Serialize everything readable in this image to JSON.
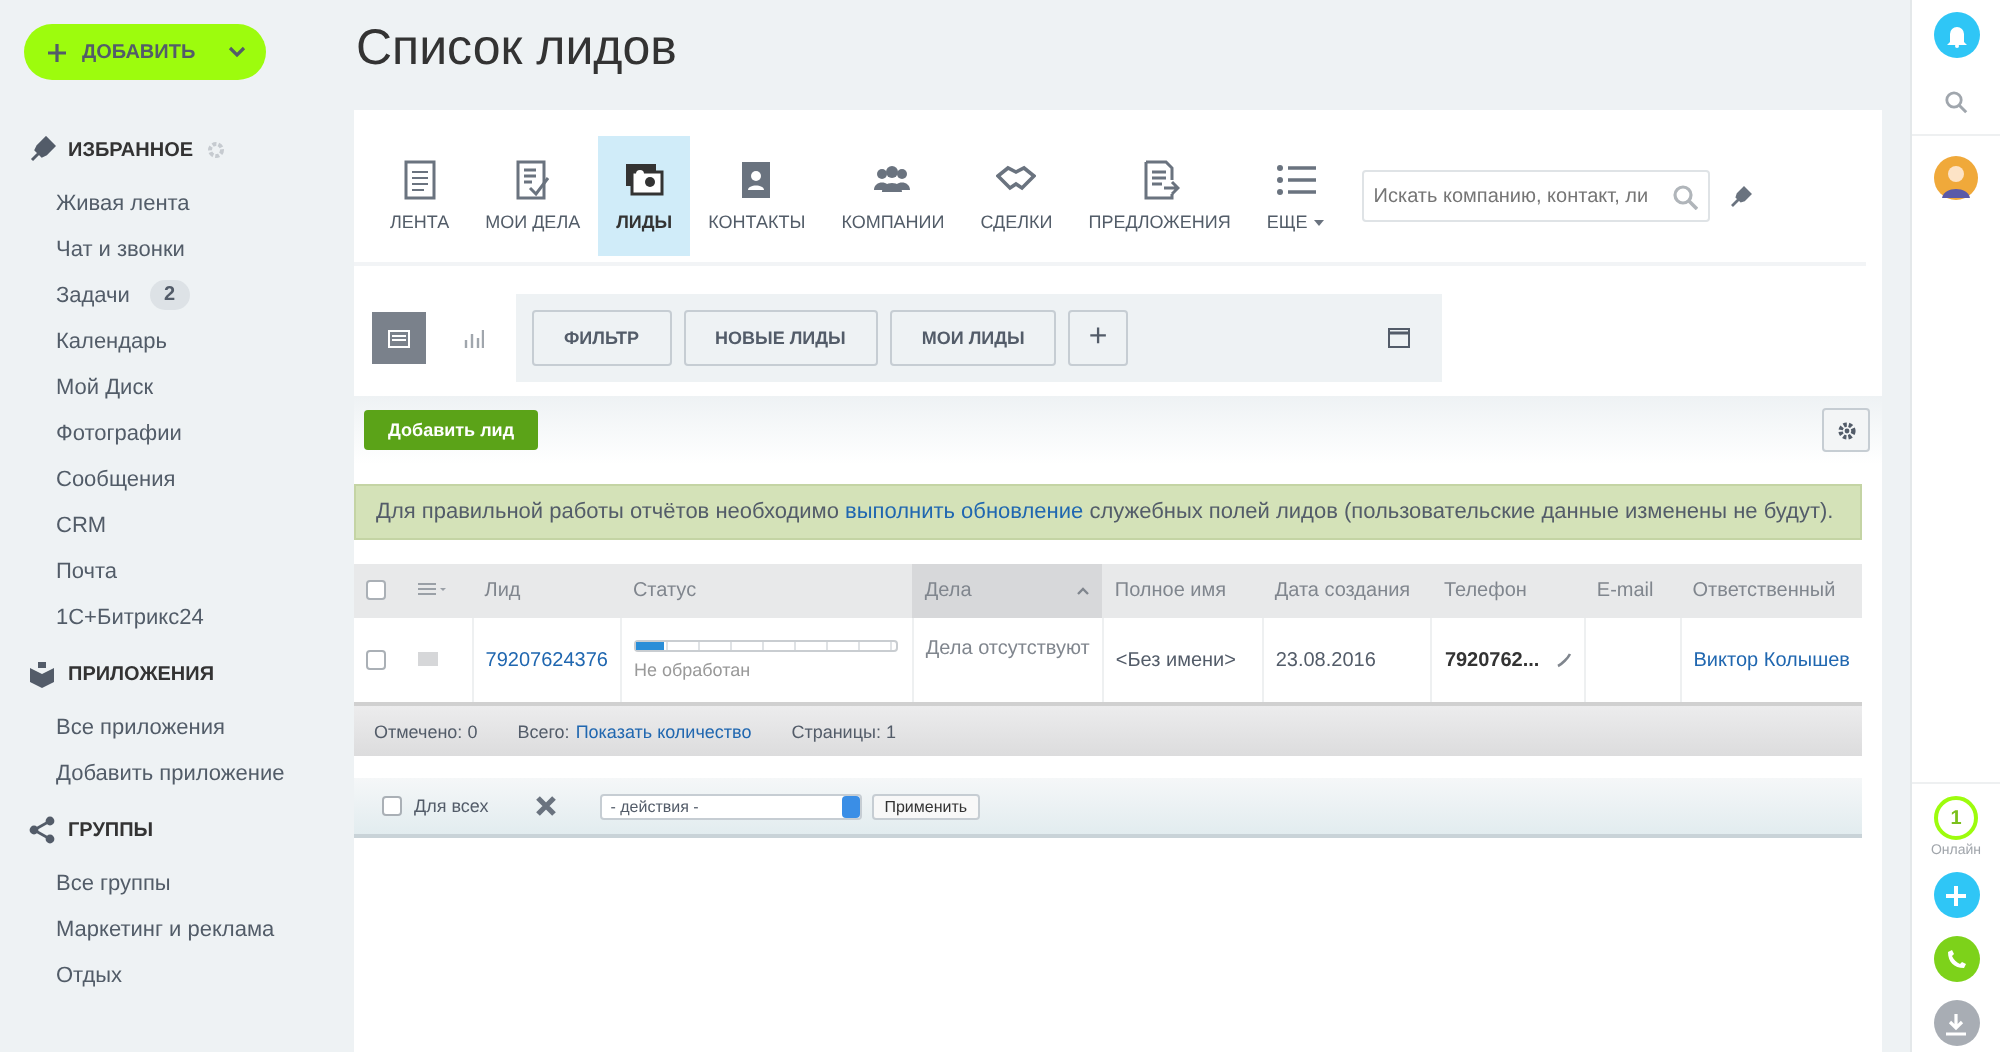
{
  "sidebar": {
    "add_button": "ДОБАВИТЬ",
    "sections": [
      {
        "title": "ИЗБРАННОЕ",
        "kind": "favorites",
        "items": [
          {
            "label": "Живая лента"
          },
          {
            "label": "Чат и звонки"
          },
          {
            "label": "Задачи",
            "counter": "2"
          },
          {
            "label": "Календарь"
          },
          {
            "label": "Мой Диск"
          },
          {
            "label": "Фотографии"
          },
          {
            "label": "Сообщения"
          },
          {
            "label": "CRM"
          },
          {
            "label": "Почта"
          },
          {
            "label": "1С+Битрикс24"
          }
        ]
      },
      {
        "title": "ПРИЛОЖЕНИЯ",
        "kind": "apps",
        "items": [
          {
            "label": "Все приложения"
          },
          {
            "label": "Добавить приложение"
          }
        ]
      },
      {
        "title": "ГРУППЫ",
        "kind": "groups",
        "items": [
          {
            "label": "Все группы"
          },
          {
            "label": "Маркетинг и реклама"
          },
          {
            "label": "Отдых"
          }
        ]
      }
    ]
  },
  "page_title": "Список лидов",
  "crm_tabs": [
    {
      "label": "ЛЕНТА",
      "kind": "tab",
      "selected": false
    },
    {
      "label": "МОИ ДЕЛА",
      "kind": "tab",
      "selected": false
    },
    {
      "label": "ЛИДЫ",
      "kind": "tab",
      "selected": true
    },
    {
      "label": "КОНТАКТЫ",
      "kind": "tab",
      "selected": false
    },
    {
      "label": "КОМПАНИИ",
      "kind": "tab",
      "selected": false
    },
    {
      "label": "СДЕЛКИ",
      "kind": "tab",
      "selected": false
    },
    {
      "label": "ПРЕДЛОЖЕНИЯ",
      "kind": "tab",
      "selected": false
    },
    {
      "label": "ЕЩЕ",
      "kind": "more",
      "selected": false
    }
  ],
  "search": {
    "placeholder": "Искать компанию, контакт, ли"
  },
  "filter_bar": {
    "views": [
      {
        "kind": "list",
        "selected": true
      },
      {
        "kind": "chart",
        "selected": false
      }
    ],
    "filters": [
      "ФИЛЬТР",
      "НОВЫЕ ЛИДЫ",
      "МОИ ЛИДЫ"
    ],
    "add": "+"
  },
  "add_lead_button": "Добавить лид",
  "notice": {
    "before": "Для правильной работы отчётов необходимо",
    "link": "выполнить обновление",
    "after": "служебных полей лидов (пользовательские данные изменены не будут)."
  },
  "table": {
    "select_all_checked": false,
    "columns": [
      {
        "label": "Лид",
        "sorted": false
      },
      {
        "label": "Статус",
        "sorted": false
      },
      {
        "label": "Дела",
        "sorted": true
      },
      {
        "label": "Полное имя",
        "sorted": false
      },
      {
        "label": "Дата создания",
        "sorted": false
      },
      {
        "label": "Телефон",
        "sorted": false
      },
      {
        "label": "E-mail",
        "sorted": false
      },
      {
        "label": "Ответственный",
        "sorted": false
      }
    ],
    "rows": [
      {
        "checked": false,
        "lead": "79207624376",
        "status": {
          "level": 0.11,
          "label": "Не обработан"
        },
        "activities": "Дела отсутствуют",
        "full_name": "<Без имени>",
        "created": "23.08.2016",
        "phone": "7920762...",
        "email": "",
        "responsible": "Виктор Колышев"
      }
    ]
  },
  "table_footer": {
    "selected": "Отмечено: 0",
    "total_label": "Всего:",
    "total_link": "Показать количество",
    "pages": "Страницы: 1"
  },
  "action_bar": {
    "for_all": {
      "label": "Для всех",
      "checked": false
    },
    "action_select": "- действия -",
    "apply_button": "Применить"
  },
  "right_bar": {
    "online_count": "1",
    "online_label": "Онлайн"
  }
}
